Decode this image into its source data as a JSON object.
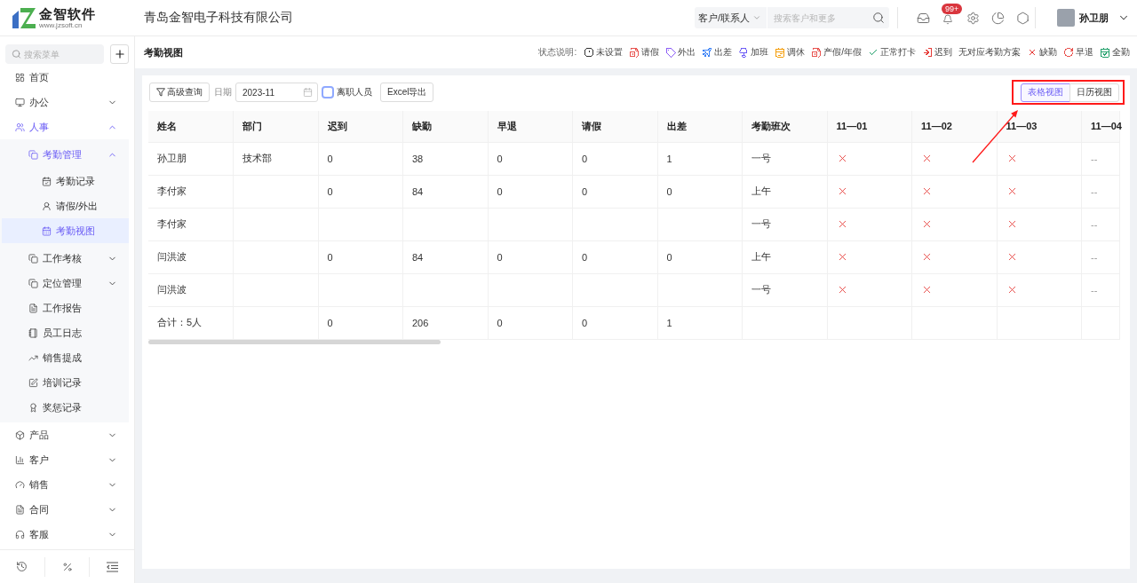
{
  "header": {
    "logo": {
      "name": "金智软件",
      "url": "www.jzsoft.cn"
    },
    "company": "青岛金智电子科技有限公司",
    "search": {
      "scope": "客户/联系人",
      "placeholder": "搜索客户和更多"
    },
    "notification_badge": "99+",
    "user": {
      "name": "孙卫朋"
    }
  },
  "sidebar": {
    "search": {
      "placeholder": "搜索菜单"
    },
    "items": [
      {
        "label": "首页",
        "selected": false
      },
      {
        "label": "办公",
        "selected": false,
        "expanded": false
      },
      {
        "label": "人事",
        "selected": false,
        "expanded": true,
        "children": [
          {
            "label": "考勤管理",
            "selected": false,
            "expanded": true,
            "children": [
              {
                "label": "考勤记录",
                "selected": false
              },
              {
                "label": "请假/外出",
                "selected": false
              },
              {
                "label": "考勤视图",
                "selected": true
              }
            ]
          },
          {
            "label": "工作考核",
            "selected": false,
            "expanded": false
          },
          {
            "label": "定位管理",
            "selected": false,
            "expanded": false
          },
          {
            "label": "工作报告",
            "selected": false
          },
          {
            "label": "员工日志",
            "selected": false
          },
          {
            "label": "销售提成",
            "selected": false
          },
          {
            "label": "培训记录",
            "selected": false
          },
          {
            "label": "奖惩记录",
            "selected": false
          }
        ]
      },
      {
        "label": "产品",
        "selected": false,
        "expanded": false
      },
      {
        "label": "客户",
        "selected": false,
        "expanded": false
      },
      {
        "label": "销售",
        "selected": false,
        "expanded": false
      },
      {
        "label": "合同",
        "selected": false,
        "expanded": false
      },
      {
        "label": "客服",
        "selected": false,
        "expanded": false
      }
    ]
  },
  "page": {
    "title": "考勤视图",
    "legend": {
      "label": "状态说明:",
      "items": [
        {
          "kind": "unset",
          "label": "未设置",
          "color": "#333333"
        },
        {
          "kind": "leave",
          "label": "请假",
          "color": "#e8534f"
        },
        {
          "kind": "out",
          "label": "外出",
          "color": "#8b5cf6"
        },
        {
          "kind": "trip",
          "label": "出差",
          "color": "#3b82f6"
        },
        {
          "kind": "overtime",
          "label": "加班",
          "color": "#6d5cf6"
        },
        {
          "kind": "rest",
          "label": "调休",
          "color": "#f59e0b"
        },
        {
          "kind": "holiday",
          "label": "产假/年假",
          "color": "#e8534f"
        },
        {
          "kind": "normal",
          "label": "正常打卡",
          "color": "#22a06b"
        },
        {
          "kind": "late",
          "label": "迟到",
          "color": "#e53935"
        },
        {
          "kind": "plain",
          "label": "无对应考勤方案"
        },
        {
          "kind": "absent",
          "label": "缺勤",
          "color": "#e53935"
        },
        {
          "kind": "early",
          "label": "早退",
          "color": "#e8534f"
        },
        {
          "kind": "full",
          "label": "全勤",
          "color": "#22a06b"
        }
      ]
    }
  },
  "toolbar": {
    "filter_button": "高级查询",
    "date": {
      "label": "日期",
      "value": "2023-11"
    },
    "resigned": {
      "label": "离职人员",
      "checked": false
    },
    "export_button": "Excel导出",
    "views": [
      {
        "label": "表格视图",
        "selected": true
      },
      {
        "label": "日历视图",
        "selected": false
      }
    ]
  },
  "table": {
    "columns": [
      "姓名",
      "部门",
      "迟到",
      "缺勤",
      "早退",
      "请假",
      "出差",
      "考勤班次"
    ],
    "day_columns": [
      "11—01",
      "11—02",
      "11—03",
      "11—04"
    ],
    "rows": [
      {
        "name": "孙卫朋",
        "department": "技术部",
        "late": "0",
        "absent": "38",
        "early_leave": "0",
        "leave": "0",
        "business_trip": "1",
        "shift": "一号",
        "days": [
          {
            "kind": "absent"
          },
          {
            "kind": "absent"
          },
          {
            "kind": "absent"
          },
          {
            "kind": "none",
            "text": "--"
          }
        ]
      },
      {
        "name": "李付家",
        "late": "0",
        "absent": "84",
        "early_leave": "0",
        "leave": "0",
        "business_trip": "0",
        "shift": "上午",
        "days": [
          {
            "kind": "absent"
          },
          {
            "kind": "absent"
          },
          {
            "kind": "absent"
          },
          {
            "kind": "none",
            "text": "--"
          }
        ]
      },
      {
        "name": "李付家",
        "shift": "一号",
        "days": [
          {
            "kind": "absent"
          },
          {
            "kind": "absent"
          },
          {
            "kind": "absent"
          },
          {
            "kind": "none",
            "text": "--"
          }
        ]
      },
      {
        "name": "闫洪波",
        "late": "0",
        "absent": "84",
        "early_leave": "0",
        "leave": "0",
        "business_trip": "0",
        "shift": "上午",
        "days": [
          {
            "kind": "absent"
          },
          {
            "kind": "absent"
          },
          {
            "kind": "absent"
          },
          {
            "kind": "none",
            "text": "--"
          }
        ]
      },
      {
        "name": "闫洪波",
        "shift": "一号",
        "days": [
          {
            "kind": "absent"
          },
          {
            "kind": "absent"
          },
          {
            "kind": "absent"
          },
          {
            "kind": "none",
            "text": "--"
          }
        ]
      }
    ],
    "summary": {
      "name": "合计：5人",
      "late": "0",
      "absent": "206",
      "early_leave": "0",
      "leave": "0",
      "business_trip": "1"
    }
  }
}
